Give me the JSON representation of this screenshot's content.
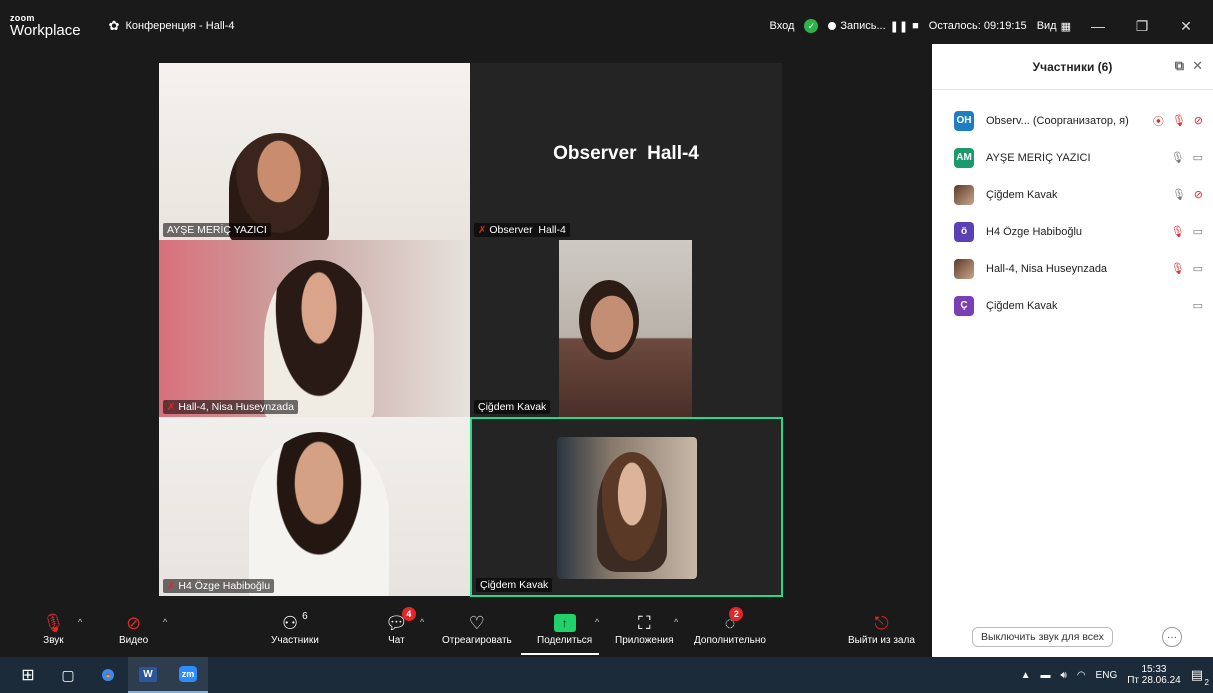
{
  "app": {
    "brand_top": "zoom",
    "brand_bottom": "Workplace",
    "conference_title": "Конференция - Hall-4"
  },
  "topbar": {
    "login": "Вход",
    "recording": "Запись...",
    "remaining": "Осталось: 09:19:15",
    "view": "Вид"
  },
  "tiles": [
    {
      "name": "AYŞE MERİÇ YAZICI",
      "muted": false
    },
    {
      "name": "Observer  Hall-4",
      "muted": true,
      "center_text": "Observer  Hall-4"
    },
    {
      "name": "Hall-4, Nisa Huseynzada",
      "muted": true
    },
    {
      "name": "Çiğdem Kavak",
      "muted": false
    },
    {
      "name": "H4 Özge Habiboğlu",
      "muted": true
    },
    {
      "name": "Çiğdem Kavak",
      "muted": false,
      "active_speaker": true
    }
  ],
  "sidebar": {
    "title": "Участники (6)",
    "participants": [
      {
        "initials": "OH",
        "color": "#1f7ec2",
        "name": "Observ...  (Соорганизатор, я)",
        "mic": "muted",
        "video": "off",
        "recording": true
      },
      {
        "initials": "AM",
        "color": "#1b9a6b",
        "name": "AYŞE MERİÇ YAZICI",
        "mic": "on",
        "video": "on"
      },
      {
        "initials": "",
        "color": "",
        "name": "Çiğdem Kavak",
        "mic": "on",
        "video": "off",
        "photo": true
      },
      {
        "initials": "ö",
        "color": "#5b3fb5",
        "name": "H4 Özge Habiboğlu",
        "mic": "muted",
        "video": "on"
      },
      {
        "initials": "",
        "color": "",
        "name": "Hall-4, Nisa Huseynzada",
        "mic": "muted",
        "video": "on",
        "photo": true
      },
      {
        "initials": "Ç",
        "color": "#7a3fb5",
        "name": "Çiğdem Kavak",
        "mic": "none",
        "video": "on"
      }
    ],
    "mute_all": "Выключить звук для всех",
    "more": "···"
  },
  "toolbar": {
    "audio": "Звук",
    "video": "Видео",
    "participants": "Участники",
    "participants_count": "6",
    "chat": "Чат",
    "chat_badge": "4",
    "react": "Отреагировать",
    "share": "Поделиться",
    "apps": "Приложения",
    "more": "Дополнительно",
    "more_badge": "2",
    "leave": "Выйти из зала"
  },
  "taskbar": {
    "lang": "ENG",
    "time": "15:33",
    "date": "Пт 28.06.24",
    "notif_count": "2",
    "word_label": "W",
    "zoom_label": "zm"
  }
}
